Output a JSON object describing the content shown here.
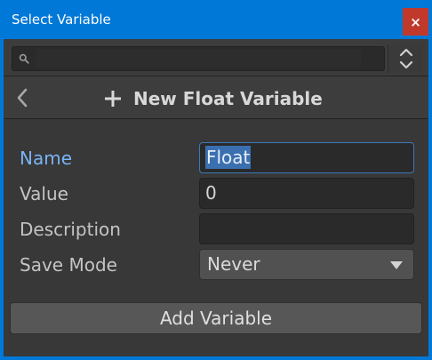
{
  "window": {
    "title": "Select Variable",
    "close_glyph": "×"
  },
  "search": {
    "value": "",
    "placeholder": ""
  },
  "header": {
    "title": "New Float Variable"
  },
  "form": {
    "name_label": "Name",
    "name_value": "Float",
    "value_label": "Value",
    "value_value": "0",
    "description_label": "Description",
    "description_value": "",
    "save_mode_label": "Save Mode",
    "save_mode_value": "Never"
  },
  "actions": {
    "add_label": "Add Variable"
  },
  "colors": {
    "title_bar": "#0078d7",
    "close_button": "#c0392b",
    "panel_bg": "#383838",
    "accent_label": "#7ab4f5",
    "selection": "#3a6fb0"
  }
}
